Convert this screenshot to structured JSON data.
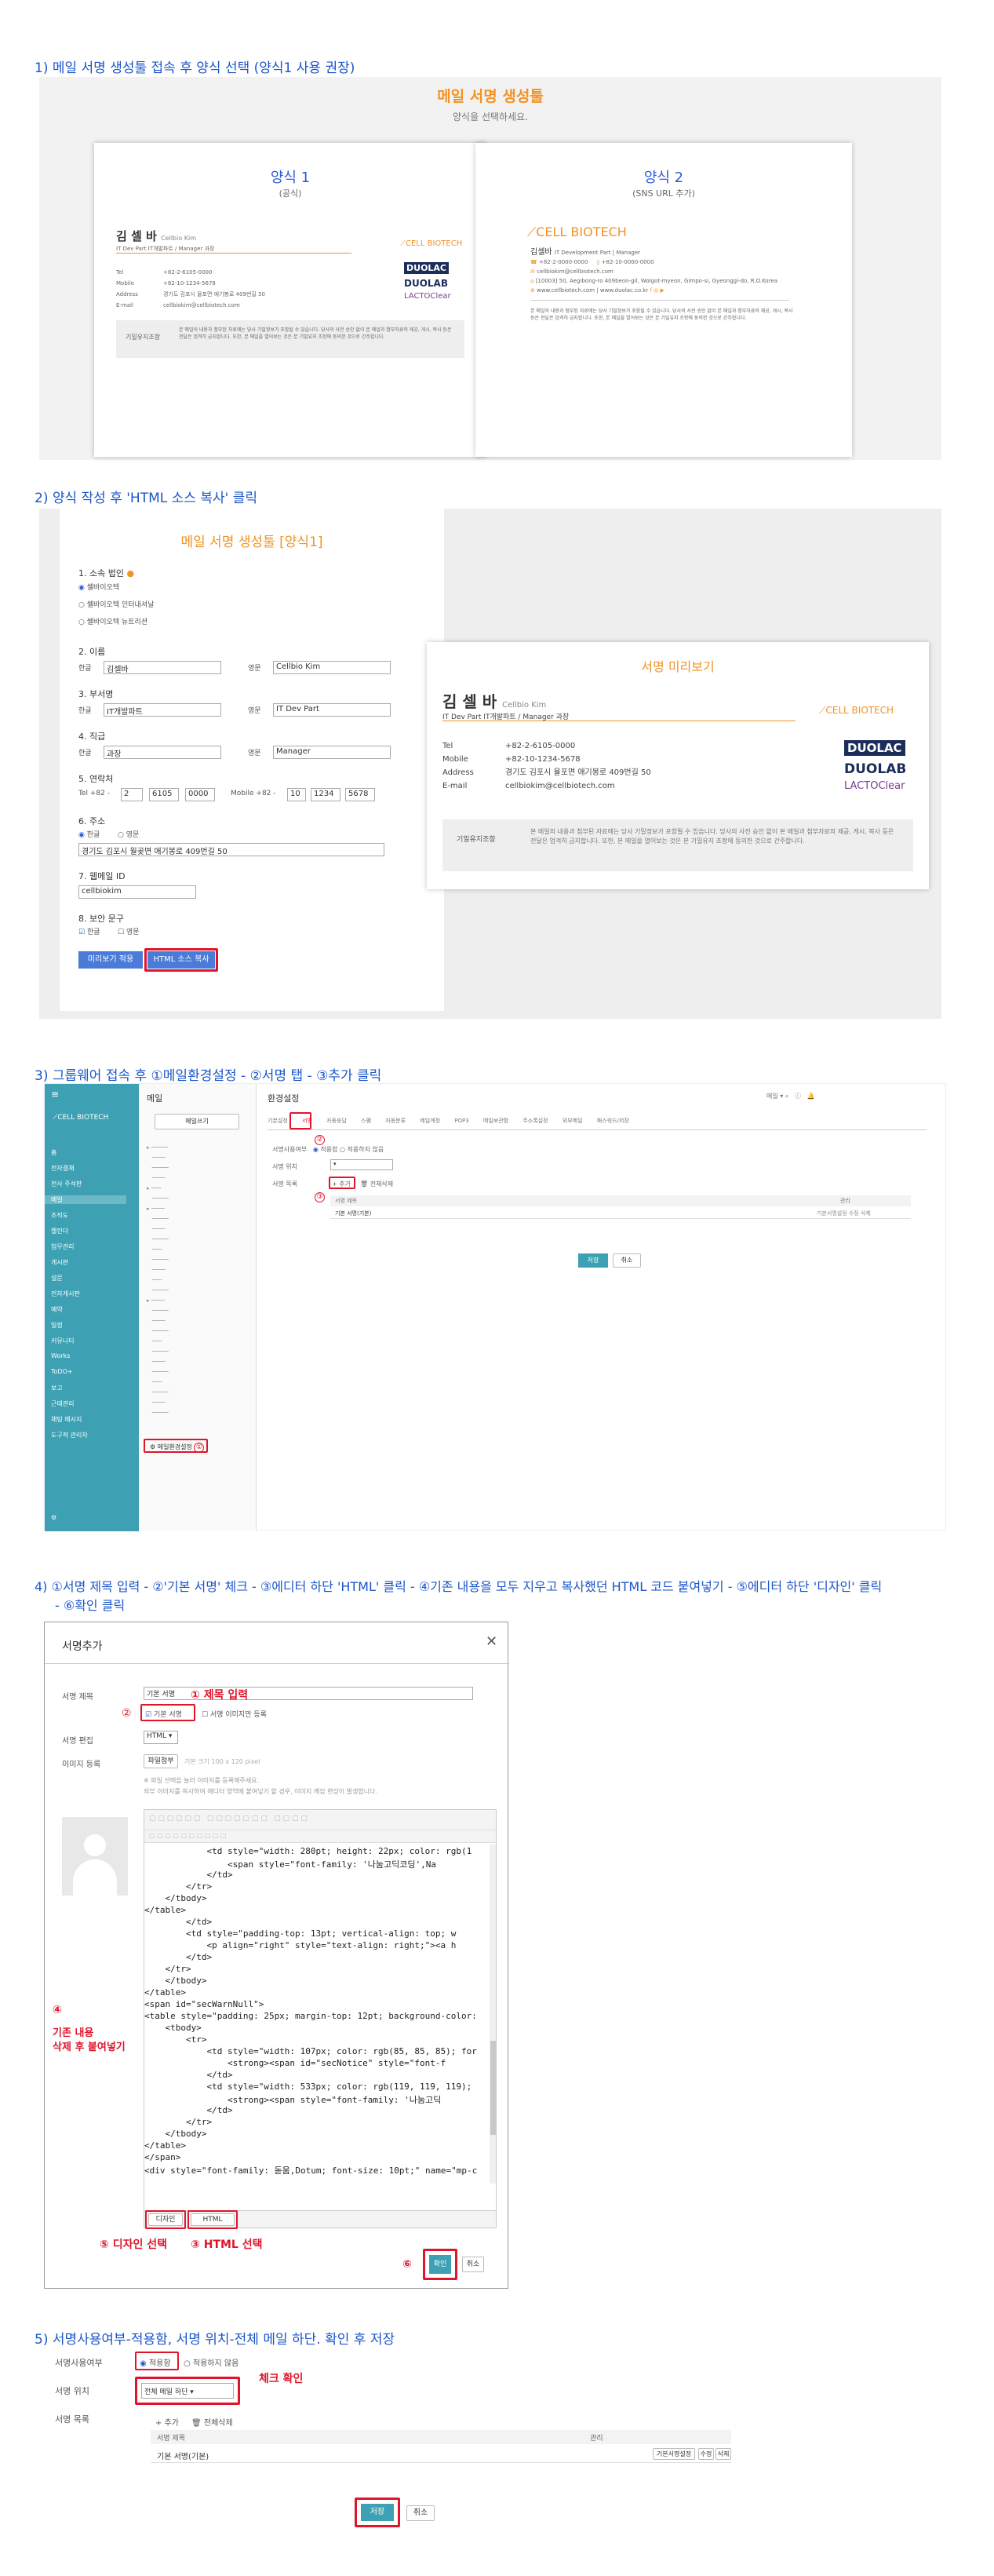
{
  "steps": {
    "s1": "1) 메일 서명 생성툴 접속 후 양식 선택 (양식1 사용 권장)",
    "s2": "2) 양식 작성 후 'HTML 소스 복사' 클릭",
    "s3": "3) 그룹웨어 접속 후 ①메일환경설정 - ②서명 탭 - ③추가 클릭",
    "s4a": "4) ①서명 제목 입력 - ②'기본 서명' 체크 - ③에디터 하단 'HTML' 클릭 - ④기존 내용을 모두 지우고 복사했던 HTML 코드 붙여넣기 - ⑤에디터 하단 '디자인' 클릭",
    "s4b": "- ⑥확인 클릭",
    "s5": "5) 서명사용여부-적용함, 서명 위치-전체 메일 하단. 확인 후 저장"
  },
  "gen": {
    "title": "메일 서명 생성툴",
    "subtitle": "양식을 선택하세요.",
    "form1_title": "양식 1",
    "form1_sub": "(공식)",
    "form2_title": "양식 2",
    "form2_sub": "(SNS URL 추가)"
  },
  "card": {
    "name": "김 셀 바",
    "name_en": "Cellbio Kim",
    "dept": "IT Dev Part IT개발파트 / Manager 과장",
    "tel_label": "Tel",
    "tel": "+82-2-6105-0000",
    "mobile_label": "Mobile",
    "mobile": "+82-10-1234-5678",
    "address_label": "Address",
    "address": "경기도 김포시 율포면 애기봉로 409번길 50",
    "email_label": "E-mail",
    "email": "cellbiokim@cellbiotech.com",
    "logo": "CELL BIOTECH",
    "brand1": "DUOLAC",
    "brand2": "DUOLAB",
    "brand3": "LACTOClear",
    "conf_label": "기밀유지조항",
    "conf_text": "본 메일의 내용과 첨부된 자료에는 당사 기밀정보가 포함될 수 있습니다. 당사의 사전 승인 없이 본 메일과 첨부자료의 제공, 게시, 복사 등은 전달은 엄격히 금지합니다. 또한, 본 메일을 열어보는 것은 본 기밀유지 조항에 동의한 것으로 간주합니다.",
    "f2_name": "김셀바",
    "f2_dept": "IT Development Part | Manager",
    "f2_phone": "+82-10-0000-0000",
    "f2_phone2": "+82-2-0000-0000",
    "f2_email": "cellbiokim@cellbiotech.com",
    "f2_addr": "[10003] 50, Aegibong-ro 409beon-gil, Wolgot-myeon, Gimpo-si, Gyeonggi-do, R.O.Korea",
    "f2_web": "www.cellbiotech.com  |  www.duolac.co.kr"
  },
  "form": {
    "title": "메일 서명 생성툴 [양식1]",
    "q1": "1. 소속 법인",
    "opt1": "쎌바이오텍",
    "opt2": "쎌바이오텍 인터내셔날",
    "opt3": "쎌바이오텍 뉴트리션",
    "q2": "2. 이름",
    "kor": "한글",
    "eng": "영문",
    "name_k": "김셀바",
    "name_e": "Cellbio Kim",
    "q3": "3. 부서명",
    "dept_k": "IT개발파트",
    "dept_e": "IT Dev Part",
    "q4": "4. 직급",
    "pos_k": "과장",
    "pos_e": "Manager",
    "q5": "5. 연락처",
    "tel": "Tel",
    "tel_cc": "+82 -",
    "tel1": "2",
    "tel2": "6105",
    "tel3": "0000",
    "mob": "Mobile",
    "mob_cc": "+82 -",
    "mob1": "10",
    "mob2": "1234",
    "mob3": "5678",
    "q6": "6. 주소",
    "addr": "경기도 김포시 월곶면 애기봉로 409번길 50",
    "q7": "7. 웹메일 ID",
    "webid": "cellbiokim",
    "q8": "8. 보안 문구",
    "preview_btn": "미리보기 적용",
    "copy_btn": "HTML 소스 복사",
    "preview_title": "서명 미리보기"
  },
  "gw": {
    "menu_title": "메일",
    "write_btn": "메일쓰기",
    "env_title": "환경설정",
    "tabs": [
      "기본설정",
      "서명",
      "자동응답",
      "스팸",
      "자동분류",
      "메일계정",
      "POP3",
      "메일보관함",
      "주소록설정",
      "외부메일",
      "패스워드/저장"
    ],
    "sig_use": "서명사용여부",
    "apply": "적용함",
    "noapply": "적용하지 않음",
    "sig_pos": "서명 위치",
    "pos_val": "전체 메일 하단",
    "sig_list": "서명 목록",
    "add": "+ 추가",
    "del_all": "전체삭제",
    "col_title": "서명 제목",
    "col_manage": "관리",
    "row1": "기본 서명(기본)",
    "row_btns": "기본서명설정   수정   삭제",
    "save": "저장",
    "cancel": "취소",
    "env_link": "메일환경설정",
    "side": [
      "홈",
      "전자결재",
      "전사 주석판",
      "메일",
      "조직도",
      "캘린더",
      "업무관리",
      "게시판",
      "설문",
      "전자게시판",
      "예약",
      "일정",
      "커뮤니티",
      "Works",
      "ToDO+",
      "보고",
      "근태관리",
      "채팅 메시지",
      "도구적 관리자"
    ]
  },
  "modal": {
    "title": "서명추가",
    "f_title": "서명 제목",
    "title_val": "기본 서명",
    "default_chk": "기본 서명",
    "img_chk": "서명 이미지만 등록",
    "f_edit": "서명 편집",
    "edit_val": "HTML",
    "f_img": "이미지 등록",
    "file_btn": "파일첨부",
    "img_hint": "기본 크기 100 x 120 pixel",
    "hint1": "※ 파일 선택을 눌러 이미지를 등록해주세요.",
    "hint2": "외부 이미지를 복사하여 에디터 영역에 붙여넣기 할 경우, 이미지 깨짐 현상이 발생합니다.",
    "design_tab": "디자인",
    "html_tab": "HTML",
    "ok": "확인",
    "cancel": "취소",
    "ann1": "① 제목 입력",
    "ann2": "②",
    "ann3": "③ HTML 선택",
    "ann4a": "④",
    "ann4b": "기존 내용",
    "ann4c": "삭제 후 붙여넣기",
    "ann5": "⑤ 디자인 선택",
    "ann6": "⑥"
  },
  "code_lines": [
    "            <td style=\"width: 280pt; height: 22px; color: rgb(1",
    "                <span style=\"font-family: '나눔고딕코딩',Na",
    "            </td>",
    "        </tr>",
    "    </tbody>",
    "</table>",
    "        </td>",
    "        <td style=\"padding-top: 13pt; vertical-align: top; w",
    "            <p align=\"right\" style=\"text-align: right;\"><a h",
    "        </td>",
    "    </tr>",
    "    </tbody>",
    "</table>",
    "<span id=\"secWarnNull\">",
    "<table style=\"padding: 25px; margin-top: 12pt; background-color:",
    "    <tbody>",
    "        <tr>",
    "            <td style=\"width: 107px; color: rgb(85, 85, 85); for",
    "                <strong><span id=\"secNotice\" style=\"font-f",
    "            </td>",
    "            <td style=\"width: 533px; color: rgb(119, 119, 119);",
    "                <strong><span style=\"font-family: '나눔고딕",
    "            </td>",
    "        </tr>",
    "    </tbody>",
    "</table>",
    "</span>",
    "<div style=\"font-family: 돋움,Dotum; font-size: 10pt;\" name=\"mp-c"
  ],
  "step5": {
    "use_label": "서명사용여부",
    "apply": "적용함",
    "noapply": "적용하지 않음",
    "pos_label": "서명 위치",
    "pos_val": "전체 메일 하단",
    "check_note": "체크 확인",
    "list_label": "서명 목록",
    "add": "+ 추가",
    "del_all": "전체삭제",
    "col_title": "서명 제목",
    "col_manage": "관리",
    "row1": "기본 서명(기본)",
    "row_b1": "기본서명설정",
    "row_b2": "수정",
    "row_b3": "삭제",
    "save": "저장",
    "cancel": "취소"
  },
  "colors": {
    "accent_blue": "#1a56c9",
    "red": "#e0152b",
    "orange": "#f39324",
    "teal": "#3da1b3"
  }
}
